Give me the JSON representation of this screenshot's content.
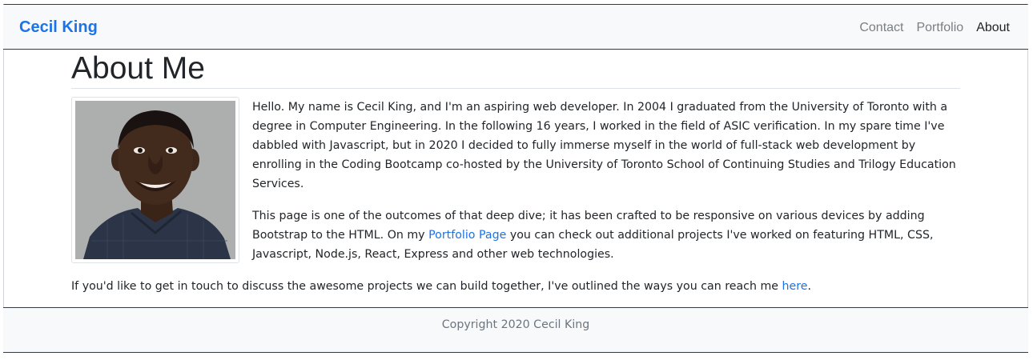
{
  "navbar": {
    "brand": "Cecil King",
    "links": [
      {
        "label": "Contact",
        "active": false
      },
      {
        "label": "Portfolio",
        "active": false
      },
      {
        "label": "About",
        "active": true
      }
    ]
  },
  "main": {
    "title": "About Me",
    "paragraph1": "Hello. My name is Cecil King, and I'm an aspiring web developer. In 2004 I graduated from the University of Toronto with a degree in Computer Engineering. In the following 16 years, I worked in the field of ASIC verification. In my spare time I've dabbled with Javascript, but in 2020 I decided to fully immerse myself in the world of full-stack web development by enrolling in the Coding Bootcamp co-hosted by the University of Toronto School of Continuing Studies and Trilogy Education Services.",
    "paragraph2": {
      "before": "This page is one of the outcomes of that deep dive; it has been crafted to be responsive on various devices by adding Bootstrap to the HTML. On my ",
      "link": "Portfolio Page",
      "after": " you can check out additional projects I've worked on featuring HTML, CSS, Javascript, Node.js, React, Express and other web technologies."
    },
    "paragraph3": {
      "before": "If you'd like to get in touch to discuss the awesome projects we can build together, I've outlined the ways you can reach me ",
      "link": "here",
      "after": "."
    }
  },
  "footer": {
    "copyright": "Copyright 2020 Cecil King"
  },
  "colors": {
    "link": "#1a73e8",
    "navbar_bg": "#f8f9fa",
    "muted": "#6c757d"
  }
}
